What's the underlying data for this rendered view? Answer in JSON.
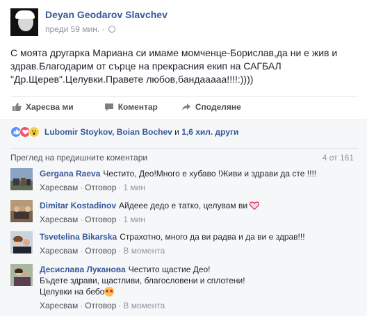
{
  "post": {
    "author": "Deyan Geodarov Slavchev",
    "time": "преди 59 мин.",
    "text": "С моята другарка Мариана си имаме момченце-Борислав,да ни е жив и здрав.Благодарим от сърце на прекрасния екип на САГБАЛ \"Др.Щерев\".Целувки.Правете любов,бандааааа!!!!:))))"
  },
  "actions": {
    "like": "Харесва ми",
    "comment": "Коментар",
    "share": "Споделяне"
  },
  "reactions": {
    "names": "Lubomir Stoykov, Boian Bochev",
    "joiner": " и ",
    "others": "1,6 хил. други"
  },
  "comments_section": {
    "view_previous": "Преглед на предишните коментари",
    "count": "4 от 161",
    "items": [
      {
        "name": "Gergana Raeva",
        "text": "Честито, Део!Много е хубаво !Живи и здрави да сте !!!!",
        "like": "Харесвам",
        "reply": "Отговор",
        "time": "1 мин"
      },
      {
        "name": "Dimitar Kostadinov",
        "text": "Айдеее дедо е татко, целувам ви",
        "like": "Харесвам",
        "reply": "Отговор",
        "time": "1 мин"
      },
      {
        "name": "Tsvetelina Bikarska",
        "text": "Страхотно, много да ви радва и да ви е здрав!!!",
        "like": "Харесвам",
        "reply": "Отговор",
        "time": "В момента"
      },
      {
        "name": "Десислава Луканова",
        "text_line1": "Честито щастие Део!",
        "text_line2": "Бъдете здрави, щастливи, благословени и сплотени!",
        "text_line3": "Целувки на бебо",
        "like": "Харесвам",
        "reply": "Отговор",
        "time": "В момента"
      }
    ]
  },
  "colors": {
    "link": "#365899",
    "muted": "#90949c",
    "like_reaction": "#5890ff",
    "love_reaction": "#f25268",
    "wow_reaction": "#f7d04a"
  }
}
